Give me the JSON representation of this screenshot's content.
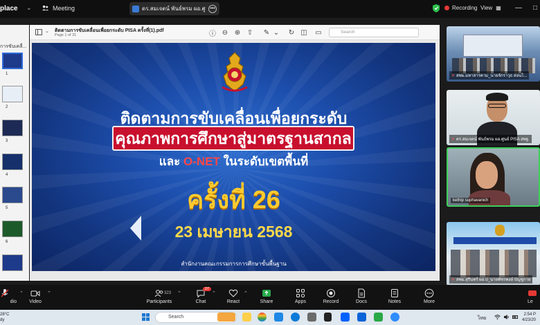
{
  "topbar": {
    "app_name": "place",
    "meeting_label": "Meeting",
    "share_pill_text": "ดร.สมเจตน์ พันธ์พรม ผอ.ศูนย์ PISA ส",
    "recording_label": "Recording",
    "view_label": "View",
    "minimize": "—",
    "restore": "□"
  },
  "thumbs": {
    "pane_title": "การขับเคลื่...",
    "pages": [
      "1",
      "2",
      "3",
      "4",
      "5",
      "6"
    ],
    "thumb_colors": [
      "#1e3a8a",
      "#e8eef6",
      "#1c2a55",
      "#16306b",
      "#2b4a8e",
      "#1d5a2a",
      "#1e3a8a"
    ]
  },
  "pdf": {
    "doc_title": "ติดตามการขับเคลื่อนเพื่อยกระดับ PISA ครั้งที่(1).pdf",
    "page_info": "Page 1 of 31",
    "search_placeholder": "Search"
  },
  "slide": {
    "line1": "ติดตามการขับเคลื่อนเพื่อยกระดับ",
    "line2": "คุณภาพการศึกษาสู่มาตรฐานสากล",
    "line3_pre": "และ",
    "line3_highlight": "O-NET",
    "line3_post": "ในระดับเขตพื้นที่",
    "round": "ครั้งที่ 26",
    "date": "23 เมษายน 2568",
    "footer": "สำนักงานคณะกรรมการการศึกษาขั้นพื้นฐาน",
    "colors": {
      "banner": "#c8102e",
      "round": "#ffcb2e",
      "highlight": "#ff4646"
    }
  },
  "gallery": {
    "tiles": [
      {
        "name": "สพม.มหาสารคาม_นายจักราวุธ สอนไ..."
      },
      {
        "name": "ดร.สมเจตน์ พันธ์พรม ผอ.ศูนย์ PISA สพฐ."
      },
      {
        "name": "kethip suphavanich"
      },
      {
        "name": "สพม.สุรินทร์ ผอ.ป_นายพัชรพงษ์ บัญชูกาย"
      }
    ]
  },
  "zoombar": {
    "audio": "dio",
    "video": "Video",
    "participants": "Participants",
    "participants_count": "323",
    "chat": "Chat",
    "chat_badge": "27",
    "react": "React",
    "share": "Share",
    "apps": "Apps",
    "record": "Record",
    "docs": "Docs",
    "notes": "Notes",
    "more": "More",
    "leave": "Le"
  },
  "taskbar": {
    "weather_temp": "28°C",
    "weather_state": "dy",
    "search_placeholder": "Search",
    "lang": "ไทย",
    "time": "2:54 P",
    "date": "4/23/20"
  }
}
